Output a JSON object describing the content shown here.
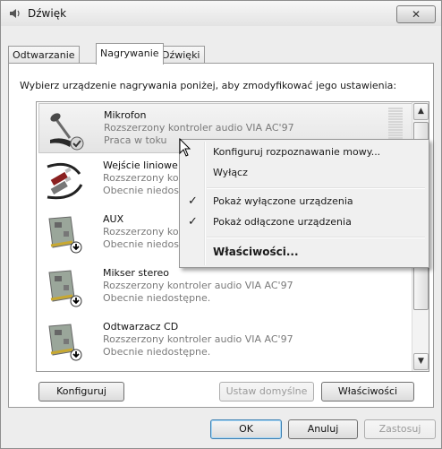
{
  "window": {
    "title": "Dźwięk",
    "close_glyph": "✕"
  },
  "tabs": [
    {
      "label": "Odtwarzanie",
      "active": false
    },
    {
      "label": "Nagrywanie",
      "active": true
    },
    {
      "label": "Dźwięki",
      "active": false
    }
  ],
  "instruction": "Wybierz urządzenie nagrywania poniżej, aby zmodyfikować jego ustawienia:",
  "devices": [
    {
      "name": "Mikrofon",
      "controller": "Rozszerzony kontroler audio VIA AC'97",
      "status": "Praca w toku",
      "icon": "microphone-icon",
      "selected": true
    },
    {
      "name": "Wejście liniowe",
      "controller": "Rozszerzony kontroler audio VIA AC'97",
      "status": "Obecnie niedostępne.",
      "icon": "line-in-icon",
      "selected": false
    },
    {
      "name": "AUX",
      "controller": "Rozszerzony kontroler audio VIA AC'97",
      "status": "Obecnie niedostępne.",
      "icon": "sound-card-icon",
      "selected": false
    },
    {
      "name": "Mikser stereo",
      "controller": "Rozszerzony kontroler audio VIA AC'97",
      "status": "Obecnie niedostępne.",
      "icon": "sound-card-icon",
      "selected": false
    },
    {
      "name": "Odtwarzacz CD",
      "controller": "Rozszerzony kontroler audio VIA AC'97",
      "status": "Obecnie niedostępne.",
      "icon": "sound-card-icon",
      "selected": false
    }
  ],
  "buttons": {
    "configure": "Konfiguruj",
    "set_default": "Ustaw domyślne",
    "properties": "Właściwości",
    "ok": "OK",
    "cancel": "Anuluj",
    "apply": "Zastosuj"
  },
  "context_menu": {
    "items": [
      {
        "label": "Konfiguruj rozpoznawanie mowy...",
        "checked": false,
        "bold": false
      },
      {
        "label": "Wyłącz",
        "checked": false,
        "bold": false
      },
      {
        "label": "Pokaż wyłączone urządzenia",
        "checked": true,
        "bold": false
      },
      {
        "label": "Pokaż odłączone urządzenia",
        "checked": true,
        "bold": false
      },
      {
        "label": "Właściwości...",
        "checked": false,
        "bold": true
      }
    ],
    "check_glyph": "✓"
  },
  "scrollbar": {
    "up_glyph": "▲",
    "down_glyph": "▼"
  },
  "colors": {
    "default_button_border": "#3c7fb1",
    "disabled_text": "#9a9a9a"
  }
}
